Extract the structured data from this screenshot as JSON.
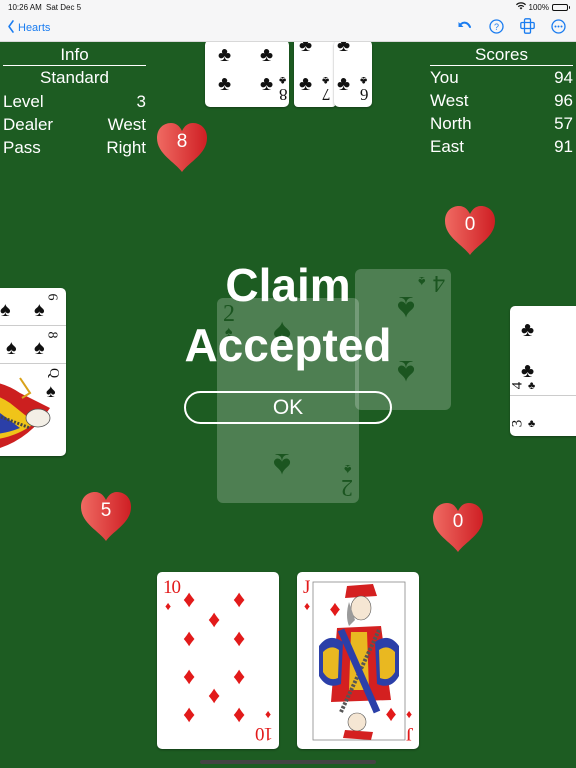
{
  "status_bar": {
    "time": "10:26 AM",
    "date": "Sat Dec 5",
    "battery": "100%"
  },
  "nav": {
    "back_label": "Hearts",
    "icons": [
      "undo-icon",
      "help-icon",
      "layout-icon",
      "more-icon"
    ]
  },
  "info": {
    "title": "Info",
    "mode": "Standard",
    "rows": [
      {
        "label": "Level",
        "value": "3"
      },
      {
        "label": "Dealer",
        "value": "West"
      },
      {
        "label": "Pass",
        "value": "Right"
      }
    ]
  },
  "scores": {
    "title": "Scores",
    "rows": [
      {
        "player": "You",
        "score": "94"
      },
      {
        "player": "West",
        "score": "96"
      },
      {
        "player": "North",
        "score": "57"
      },
      {
        "player": "East",
        "score": "91"
      }
    ]
  },
  "heart_counts": {
    "north": "8",
    "east": "0",
    "west": "5",
    "south": "0"
  },
  "hands": {
    "north": [
      {
        "rank": "8",
        "suit": "♣"
      },
      {
        "rank": "7",
        "suit": "♣"
      },
      {
        "rank": "6",
        "suit": "♣"
      }
    ],
    "west": [
      {
        "rank": "6",
        "suit": "♠"
      },
      {
        "rank": "8",
        "suit": "♠"
      },
      {
        "rank": "Q",
        "suit": "♠"
      }
    ],
    "east": [
      {
        "rank": "4",
        "suit": "♣"
      },
      {
        "rank": "3",
        "suit": "♣"
      }
    ],
    "south": [
      {
        "rank": "10",
        "suit": "♦"
      },
      {
        "rank": "J",
        "suit": "♦"
      }
    ]
  },
  "trick": [
    {
      "rank": "2",
      "suit": "♠"
    },
    {
      "rank": "4",
      "suit": "♠"
    }
  ],
  "dialog": {
    "line1": "Claim",
    "line2": "Accepted",
    "ok_label": "OK"
  },
  "colors": {
    "table": "#1d5c22",
    "heart": "#e03a3a",
    "accent": "#1a7cf0"
  }
}
